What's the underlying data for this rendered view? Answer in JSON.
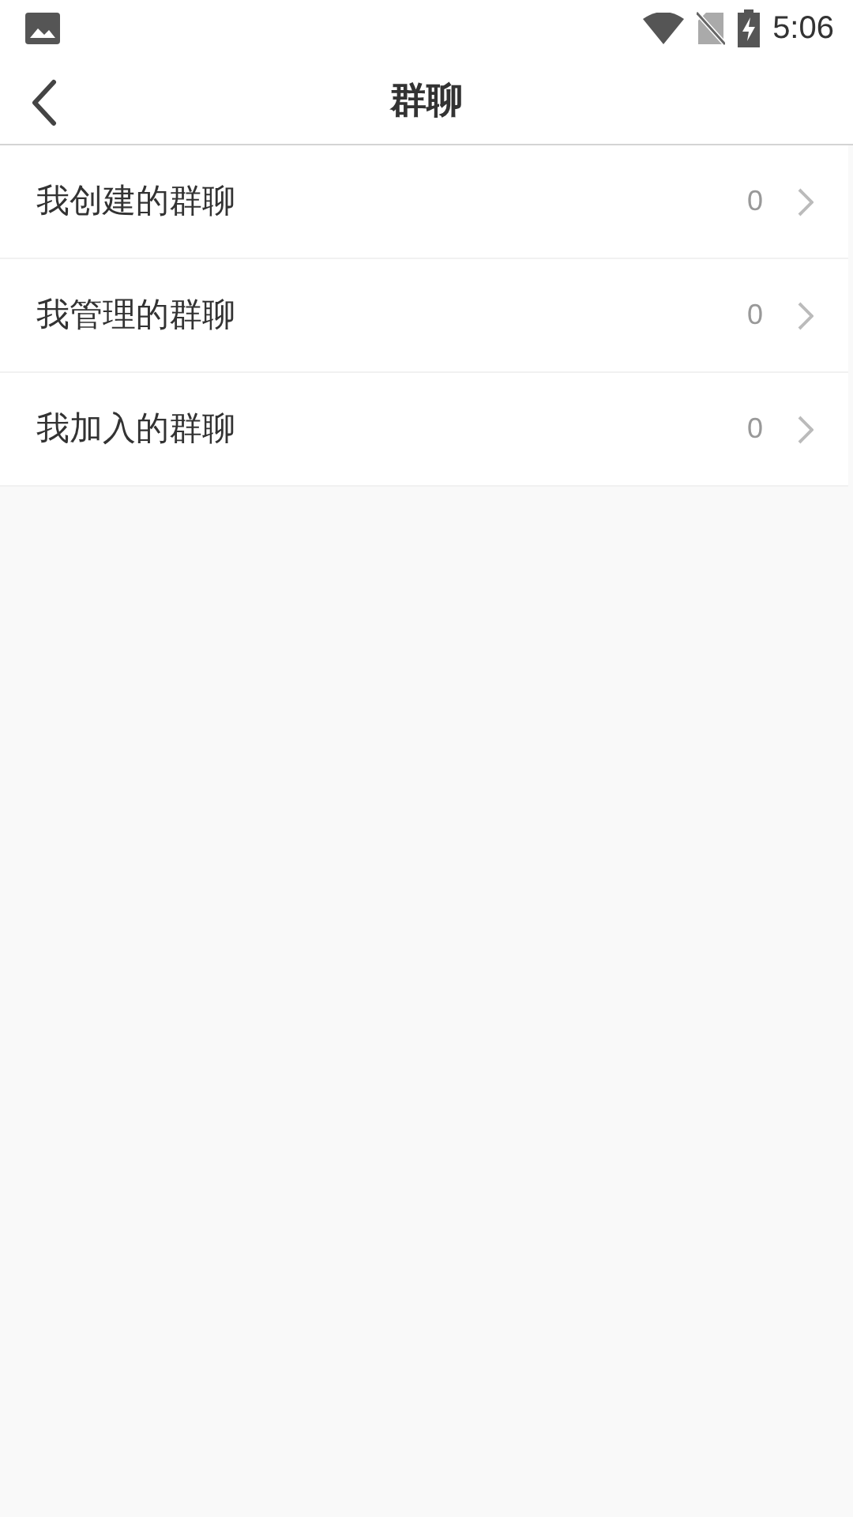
{
  "status_bar": {
    "time": "5:06"
  },
  "header": {
    "title": "群聊"
  },
  "items": [
    {
      "label": "我创建的群聊",
      "count": "0"
    },
    {
      "label": "我管理的群聊",
      "count": "0"
    },
    {
      "label": "我加入的群聊",
      "count": "0"
    }
  ]
}
